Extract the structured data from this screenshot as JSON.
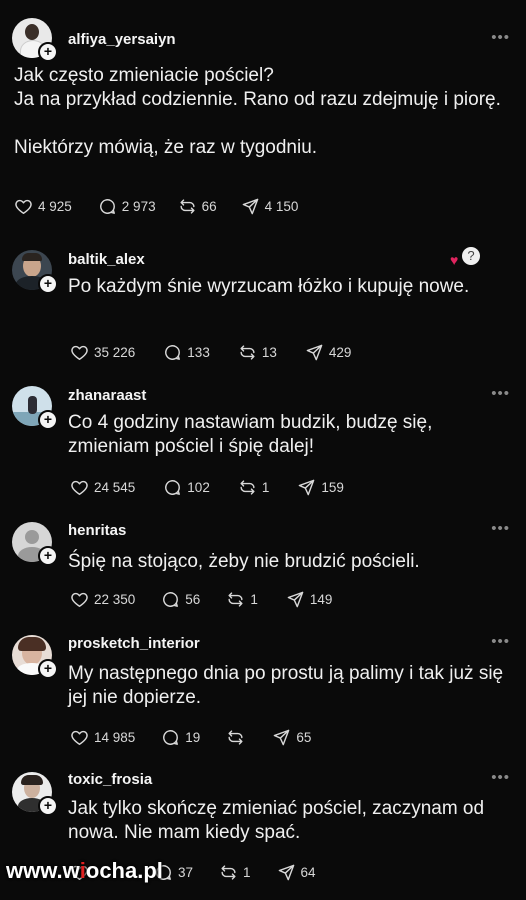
{
  "posts": [
    {
      "username": "alfiya_yersaiyn",
      "text": "Jak często zmieniacie pościel?\nJa na przykład codziennie. Rano od razu zdejmuję i piorę.\n\nNiektórzy mówią, że raz w tygodniu.",
      "likes": "4 925",
      "comments": "2 973",
      "reposts": "66",
      "shares": "4 150"
    },
    {
      "username": "baltik_alex",
      "text": "Po każdym śnie wyrzucam łóżko i kupuję nowe.",
      "likes": "35 226",
      "comments": "133",
      "reposts": "13",
      "shares": "429"
    },
    {
      "username": "zhanaraast",
      "text": "Co 4 godziny nastawiam budzik, budzę się, zmieniam pościel i śpię dalej!",
      "likes": "24 545",
      "comments": "102",
      "reposts": "1",
      "shares": "159"
    },
    {
      "username": "henritas",
      "text": "Śpię na stojąco, żeby nie brudzić pościeli.",
      "likes": "22 350",
      "comments": "56",
      "reposts": "1",
      "shares": "149"
    },
    {
      "username": "prosketch_interior",
      "text": "My następnego dnia po prostu ją palimy i tak już się jej nie dopierze.",
      "likes": "14 985",
      "comments": "19",
      "reposts": "",
      "shares": "65"
    },
    {
      "username": "toxic_frosia",
      "text": "Jak tylko skończę zmieniać pościel, zaczynam od nowa. Nie mam kiedy spać.",
      "likes": "",
      "comments": "37",
      "reposts": "1",
      "shares": "64"
    }
  ],
  "watermark": {
    "pre": "www.w",
    "red": "i",
    "post": "ocha.pl"
  },
  "icons": {
    "more": "more-horizontal-icon",
    "like": "heart-icon",
    "comment": "comment-icon",
    "repost": "repost-icon",
    "share": "send-icon"
  }
}
